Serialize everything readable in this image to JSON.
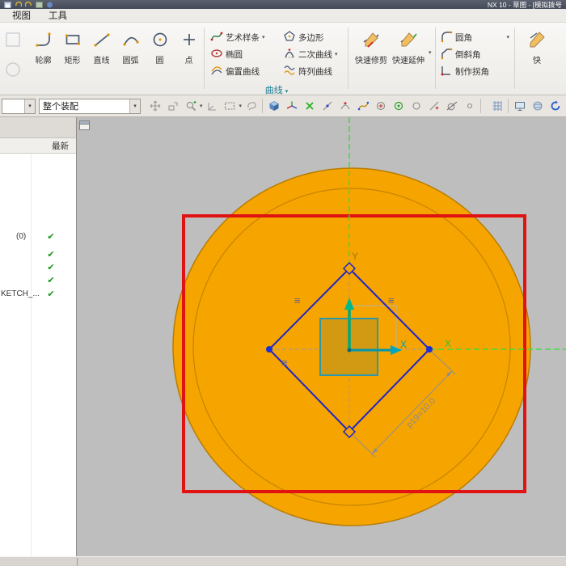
{
  "window": {
    "title": "NX 10 - 草图 - [模拟拨号",
    "menu": [
      "视图",
      "工具"
    ]
  },
  "ribbon": {
    "big_tools": [
      {
        "label": "轮廓"
      },
      {
        "label": "矩形"
      },
      {
        "label": "直线"
      },
      {
        "label": "圆弧"
      },
      {
        "label": "圆"
      },
      {
        "label": "点"
      }
    ],
    "curve_group": {
      "label": "曲线",
      "col1": [
        {
          "label": "艺术样条"
        },
        {
          "label": "椭圆"
        },
        {
          "label": "偏置曲线"
        }
      ],
      "col2": [
        {
          "label": "多边形"
        },
        {
          "label": "二次曲线"
        },
        {
          "label": "阵列曲线"
        }
      ]
    },
    "edit_tools": [
      {
        "label": "快速修剪"
      },
      {
        "label": "快速延伸"
      }
    ],
    "corner_tools": [
      {
        "label": "圆角"
      },
      {
        "label": "倒斜角"
      },
      {
        "label": "制作拐角"
      }
    ],
    "overflow_tool": {
      "label": "快"
    }
  },
  "toolbar": {
    "type_filter": "",
    "selection_scope": "整个装配"
  },
  "sidebar": {
    "header": "最新",
    "rows": [
      {
        "label": "(0)",
        "check": "✔"
      },
      {
        "label": "",
        "check": "✔"
      },
      {
        "label": "",
        "check": "✔"
      },
      {
        "label": "",
        "check": "✔"
      },
      {
        "label": "KETCH_...",
        "check": "✔"
      }
    ]
  },
  "viewport": {
    "dim_label": "p19=10.0",
    "y_label": "Y",
    "x_label": "X",
    "x_label2": "X"
  }
}
